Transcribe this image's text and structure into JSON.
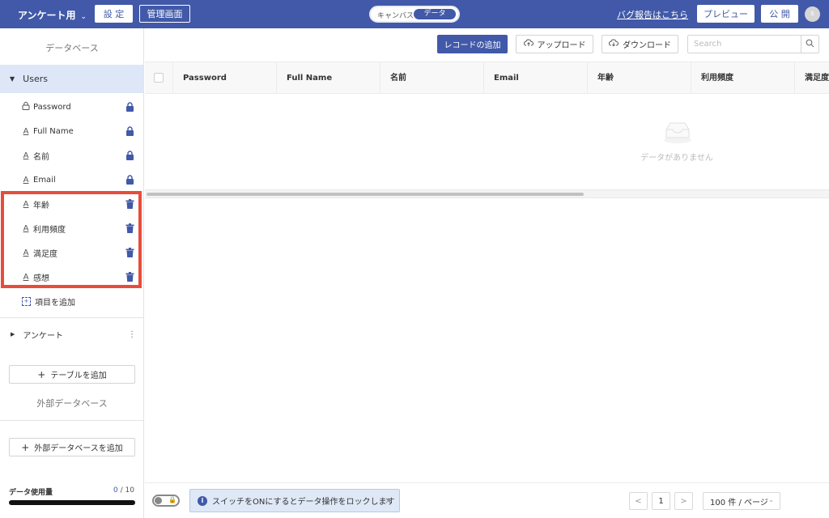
{
  "topbar": {
    "app_name": "アンケート用",
    "settings_label": "設 定",
    "admin_label": "管理画面",
    "mode_canvas": "キャンバス",
    "mode_data": "データ",
    "bug_report": "バグ報告はこちら",
    "preview_label": "プレビュー",
    "publish_label": "公 開",
    "avatar_initial": "s"
  },
  "sidebar": {
    "database_heading": "データベース",
    "tables": [
      {
        "name": "Users",
        "fields": [
          {
            "icon": "lock-field-icon",
            "label": "Password",
            "action": "locked"
          },
          {
            "icon": "text-field-icon",
            "label": "Full Name",
            "action": "locked"
          },
          {
            "icon": "text-field-icon",
            "label": "名前",
            "action": "locked"
          },
          {
            "icon": "text-field-icon",
            "label": "Email",
            "action": "locked"
          },
          {
            "icon": "text-field-icon",
            "label": "年齢",
            "action": "delete"
          },
          {
            "icon": "text-field-icon",
            "label": "利用頻度",
            "action": "delete"
          },
          {
            "icon": "text-field-icon",
            "label": "満足度",
            "action": "delete"
          },
          {
            "icon": "text-field-icon",
            "label": "感想",
            "action": "delete"
          }
        ],
        "add_field_label": "項目を追加"
      },
      {
        "name": "アンケート"
      }
    ],
    "add_table_label": "テーブルを追加",
    "external_heading": "外部データベース",
    "add_external_label": "外部データベースを追加",
    "usage_label": "データ使用量",
    "usage_used": "0",
    "usage_total": " / 10",
    "usage_fraction": 0
  },
  "toolbar": {
    "add_record": "レコードの追加",
    "upload": "アップロード",
    "download": "ダウンロード",
    "search_placeholder": "Search"
  },
  "grid": {
    "columns": [
      "Password",
      "Full Name",
      "名前",
      "Email",
      "年齢",
      "利用頻度",
      "満足度"
    ],
    "empty_text": "データがありません"
  },
  "footer": {
    "lock_notice": "スイッチをONにするとデータ操作をロックします",
    "close_glyph": "×",
    "prev": "<",
    "current_page": "1",
    "next": ">",
    "page_size": "100 件 / ページ"
  },
  "colors": {
    "brand": "#4159a8",
    "highlight": "#e74c3c",
    "selected_row": "#dde7f8"
  }
}
